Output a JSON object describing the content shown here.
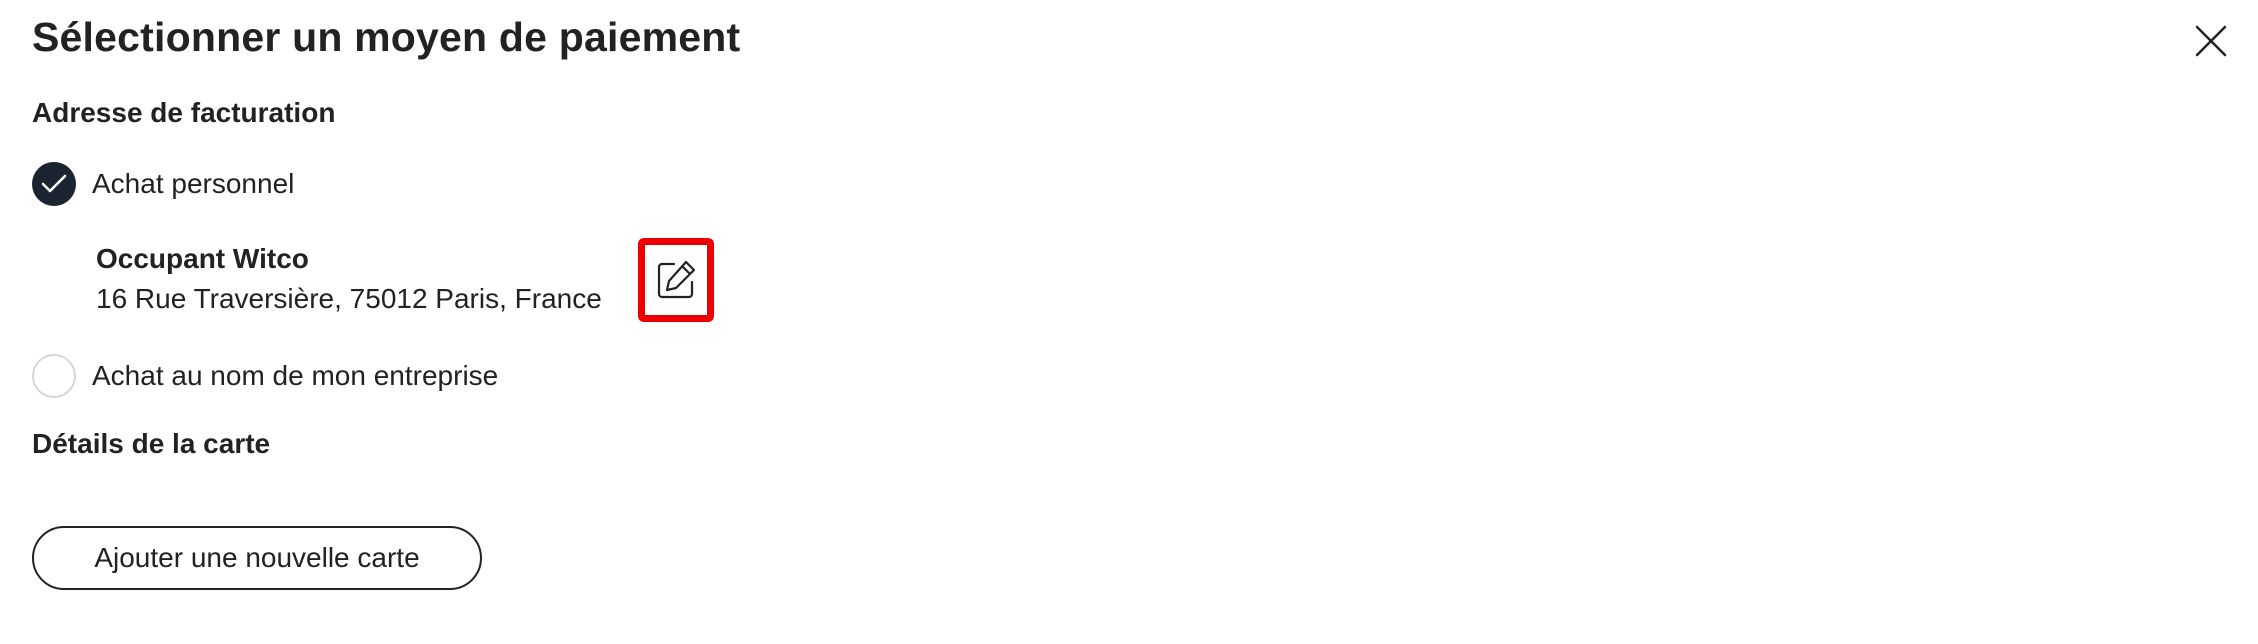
{
  "dialog": {
    "title": "Sélectionner un moyen de paiement",
    "close_icon": "close-icon"
  },
  "billing": {
    "heading": "Adresse de facturation",
    "options": [
      {
        "label": "Achat personnel",
        "selected": true
      },
      {
        "label": "Achat au nom de mon entreprise",
        "selected": false
      }
    ],
    "address": {
      "name": "Occupant Witco",
      "line": "16 Rue Traversière, 75012 Paris, France"
    },
    "edit_icon": "edit-icon",
    "edit_highlight_color": "#ee0000"
  },
  "card": {
    "heading": "Détails de la carte",
    "add_button_label": "Ajouter une nouvelle carte"
  },
  "colors": {
    "checked_radio": "#1c2331",
    "text": "#222222"
  }
}
